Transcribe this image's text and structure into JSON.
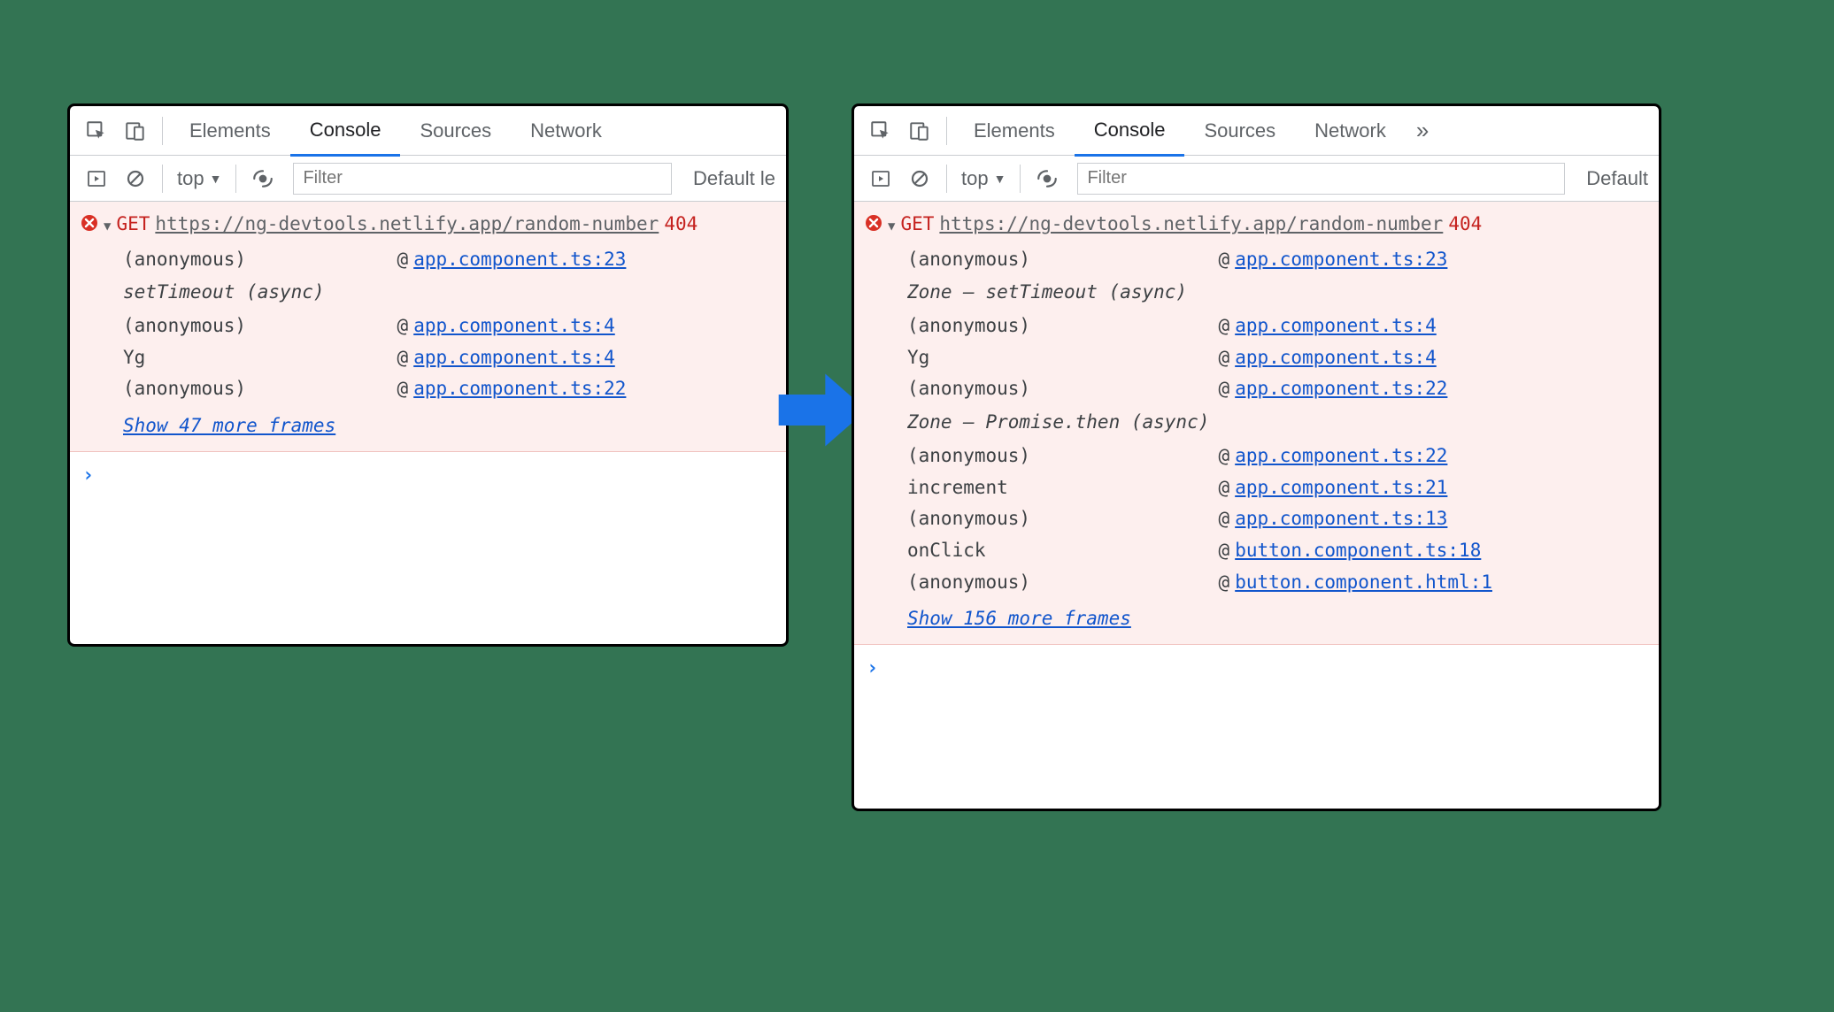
{
  "tabs": {
    "elements": "Elements",
    "console": "Console",
    "sources": "Sources",
    "network": "Network",
    "more": "»"
  },
  "toolbar": {
    "context": "top",
    "filter_placeholder": "Filter",
    "levels_left": "Default le",
    "levels_right": "Default"
  },
  "left": {
    "method": "GET",
    "url": "https://ng-devtools.netlify.app/random-number",
    "status": "404",
    "stack": [
      {
        "fn": "(anonymous)",
        "loc": "app.component.ts:23"
      }
    ],
    "async1": "setTimeout (async)",
    "stack2": [
      {
        "fn": "(anonymous)",
        "loc": "app.component.ts:4"
      },
      {
        "fn": "Yg",
        "loc": "app.component.ts:4"
      },
      {
        "fn": "(anonymous)",
        "loc": "app.component.ts:22"
      }
    ],
    "show_more": "Show 47 more frames"
  },
  "right": {
    "method": "GET",
    "url": "https://ng-devtools.netlify.app/random-number",
    "status": "404",
    "stack": [
      {
        "fn": "(anonymous)",
        "loc": "app.component.ts:23"
      }
    ],
    "async1": "Zone — setTimeout (async)",
    "stack2": [
      {
        "fn": "(anonymous)",
        "loc": "app.component.ts:4"
      },
      {
        "fn": "Yg",
        "loc": "app.component.ts:4"
      },
      {
        "fn": "(anonymous)",
        "loc": "app.component.ts:22"
      }
    ],
    "async2": "Zone — Promise.then (async)",
    "stack3": [
      {
        "fn": "(anonymous)",
        "loc": "app.component.ts:22"
      },
      {
        "fn": "increment",
        "loc": "app.component.ts:21"
      },
      {
        "fn": "(anonymous)",
        "loc": "app.component.ts:13"
      },
      {
        "fn": "onClick",
        "loc": "button.component.ts:18"
      },
      {
        "fn": "(anonymous)",
        "loc": "button.component.html:1"
      }
    ],
    "show_more": "Show 156 more frames"
  }
}
